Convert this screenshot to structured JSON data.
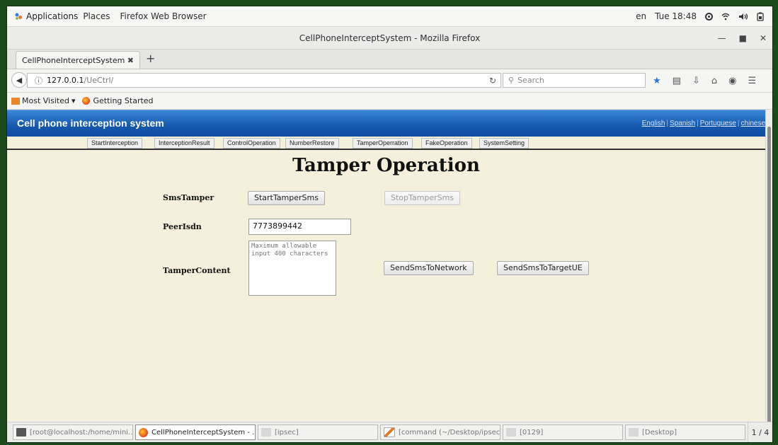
{
  "os_topbar": {
    "applications": "Applications",
    "places": "Places",
    "app_name": "Firefox Web Browser",
    "lang": "en",
    "clock": "Tue 18:48"
  },
  "window": {
    "title": "CellPhoneInterceptSystem - Mozilla Firefox"
  },
  "tab": {
    "label": "CellPhoneInterceptSystem"
  },
  "navbar": {
    "url_host": "127.0.0.1",
    "url_path": "/UeCtrl/",
    "search_placeholder": "Search"
  },
  "bookmarks": {
    "most_visited": "Most Visited",
    "getting_started": "Getting Started"
  },
  "site": {
    "title": "Cell phone interception system",
    "languages": [
      "English",
      "Spanish",
      "Portuguese",
      "chinese"
    ]
  },
  "menu": [
    "StartInterception",
    "InterceptionResult",
    "ControlOperation",
    "NumberRestore",
    "TamperOperration",
    "FakeOperation",
    "SystemSetting"
  ],
  "page": {
    "heading": "Tamper Operation",
    "sms_tamper_label": "SmsTamper",
    "start_button": "StartTamperSms",
    "stop_button": "StopTamperSms",
    "peer_label": "PeerIsdn",
    "peer_value": "7773899442",
    "content_label": "TamperContent",
    "content_placeholder": "Maximum allowable input 400 characters",
    "send_network_button": "SendSmsToNetwork",
    "send_target_button": "SendSmsToTargetUE"
  },
  "taskbar": {
    "tasks": [
      "[root@localhost:/home/mini...",
      "CellPhoneInterceptSystem - ...",
      "[ipsec]",
      "[command (~/Desktop/ipsec...",
      "[0129]",
      "[Desktop]"
    ],
    "pager": "1 / 4"
  }
}
